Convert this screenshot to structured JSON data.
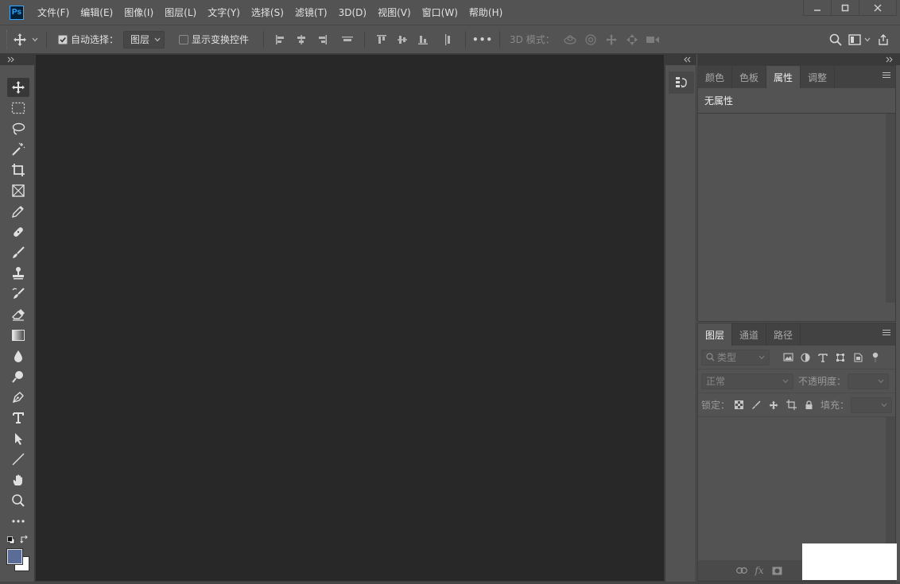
{
  "app": {
    "logo_text": "Ps",
    "menu": [
      "文件(F)",
      "编辑(E)",
      "图像(I)",
      "图层(L)",
      "文字(Y)",
      "选择(S)",
      "滤镜(T)",
      "3D(D)",
      "视图(V)",
      "窗口(W)",
      "帮助(H)"
    ],
    "window_controls": {
      "minimize": "—",
      "maximize": "□",
      "close": "✕"
    }
  },
  "options_bar": {
    "auto_select_label": "自动选择：",
    "auto_select_checked": true,
    "auto_select_target": "图层",
    "show_transform_label": "显示变换控件",
    "show_transform_checked": false,
    "more_label": "•••",
    "mode_3d_label": "3D 模式："
  },
  "tools": [
    "move-tool",
    "marquee-tool",
    "lasso-tool",
    "magic-wand-tool",
    "crop-tool",
    "frame-tool",
    "eyedropper-tool",
    "healing-brush-tool",
    "brush-tool",
    "clone-stamp-tool",
    "history-brush-tool",
    "eraser-tool",
    "gradient-tool",
    "blur-tool",
    "dodge-tool",
    "pen-tool",
    "type-tool",
    "path-selection-tool",
    "line-tool",
    "hand-tool",
    "zoom-tool",
    "edit-toolbar"
  ],
  "colors": {
    "foreground": "#5b6d96",
    "background": "#ffffff",
    "ui_bg": "#535353",
    "canvas_bg": "#282828",
    "accent": "#31a8ff"
  },
  "properties_panel": {
    "tabs": [
      "颜色",
      "色板",
      "属性",
      "调整"
    ],
    "active_tab": "属性",
    "content": "无属性"
  },
  "layers_panel": {
    "tabs": [
      "图层",
      "通道",
      "路径"
    ],
    "active_tab": "图层",
    "filter_placeholder": "类型",
    "blend_mode": "正常",
    "opacity_label": "不透明度：",
    "lock_label": "锁定：",
    "fill_label": "填充：",
    "footer_fx": "fx"
  }
}
